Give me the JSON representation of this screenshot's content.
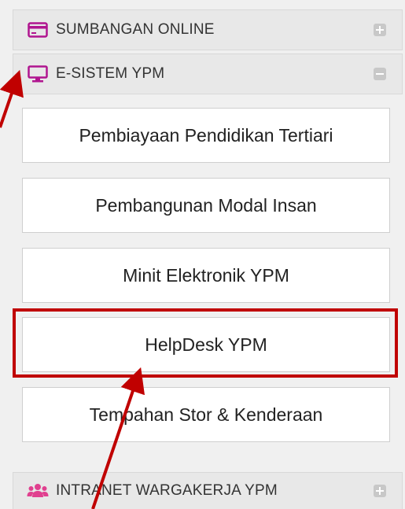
{
  "menu": {
    "sumbangan": {
      "label": "SUMBANGAN ONLINE",
      "icon": "credit-card-icon",
      "state": "collapsed"
    },
    "esistem": {
      "label": "E-SISTEM YPM",
      "icon": "monitor-icon",
      "state": "expanded",
      "items": [
        {
          "label": "Pembiayaan Pendidikan Tertiari"
        },
        {
          "label": "Pembangunan Modal Insan"
        },
        {
          "label": "Minit Elektronik YPM"
        },
        {
          "label": "HelpDesk YPM"
        },
        {
          "label": "Tempahan Stor & Kenderaan"
        }
      ]
    },
    "intranet": {
      "label": "INTRANET WARGAKERJA YPM",
      "icon": "users-icon",
      "state": "collapsed"
    }
  },
  "annotations": {
    "highlight_color": "#c00000",
    "highlighted_item": "HelpDesk YPM"
  },
  "colors": {
    "header_icon": "#b0158f",
    "users_icon": "#e0408f",
    "toggle": "#c8c8c8",
    "background": "#f0f0f0"
  }
}
